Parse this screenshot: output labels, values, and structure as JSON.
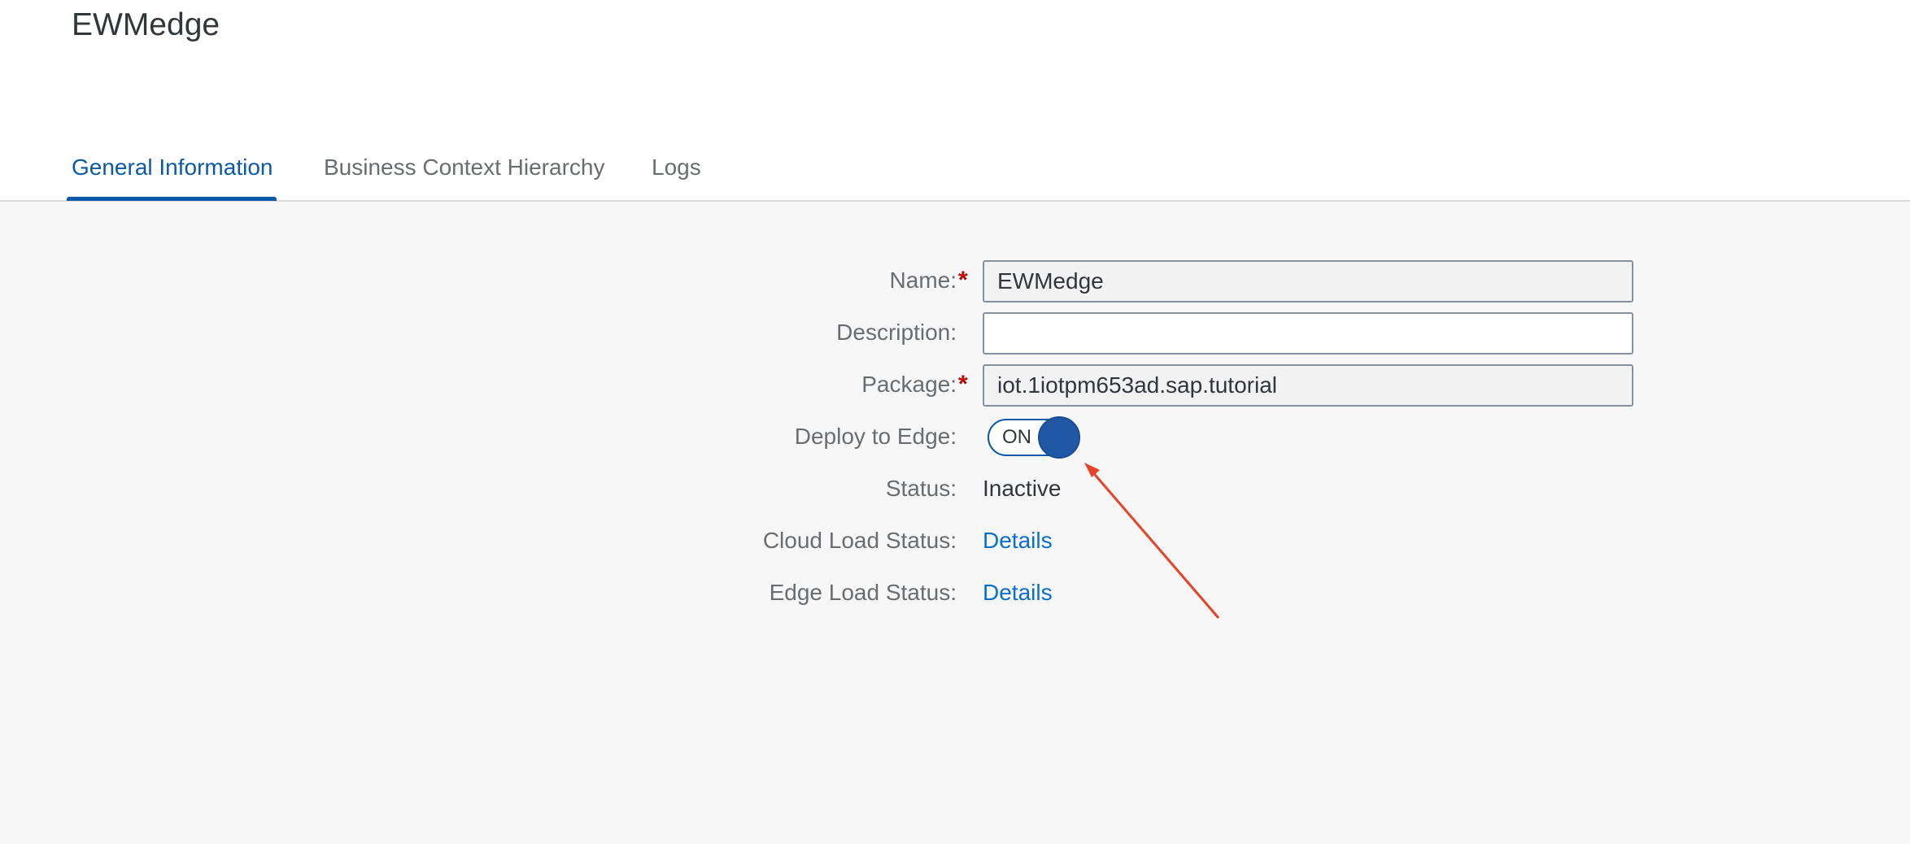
{
  "page": {
    "title": "EWMedge"
  },
  "tabs": [
    {
      "label": "General Information",
      "active": true
    },
    {
      "label": "Business Context Hierarchy",
      "active": false
    },
    {
      "label": "Logs",
      "active": false
    }
  ],
  "form": {
    "name": {
      "label": "Name:",
      "required_mark": "*",
      "value": "EWMedge"
    },
    "description": {
      "label": "Description:",
      "value": ""
    },
    "package": {
      "label": "Package:",
      "required_mark": "*",
      "value": "iot.1iotpm653ad.sap.tutorial"
    },
    "deploy_to_edge": {
      "label": "Deploy to Edge:",
      "toggle_text": "ON",
      "state": "on"
    },
    "status": {
      "label": "Status:",
      "value": "Inactive"
    },
    "cloud_load_status": {
      "label": "Cloud Load Status:",
      "link": "Details"
    },
    "edge_load_status": {
      "label": "Edge Load Status:",
      "link": "Details"
    }
  },
  "colors": {
    "accent": "#0a5aa8",
    "link": "#0a6ed1",
    "required": "#bb0000",
    "annotation_arrow": "#e8432a"
  }
}
